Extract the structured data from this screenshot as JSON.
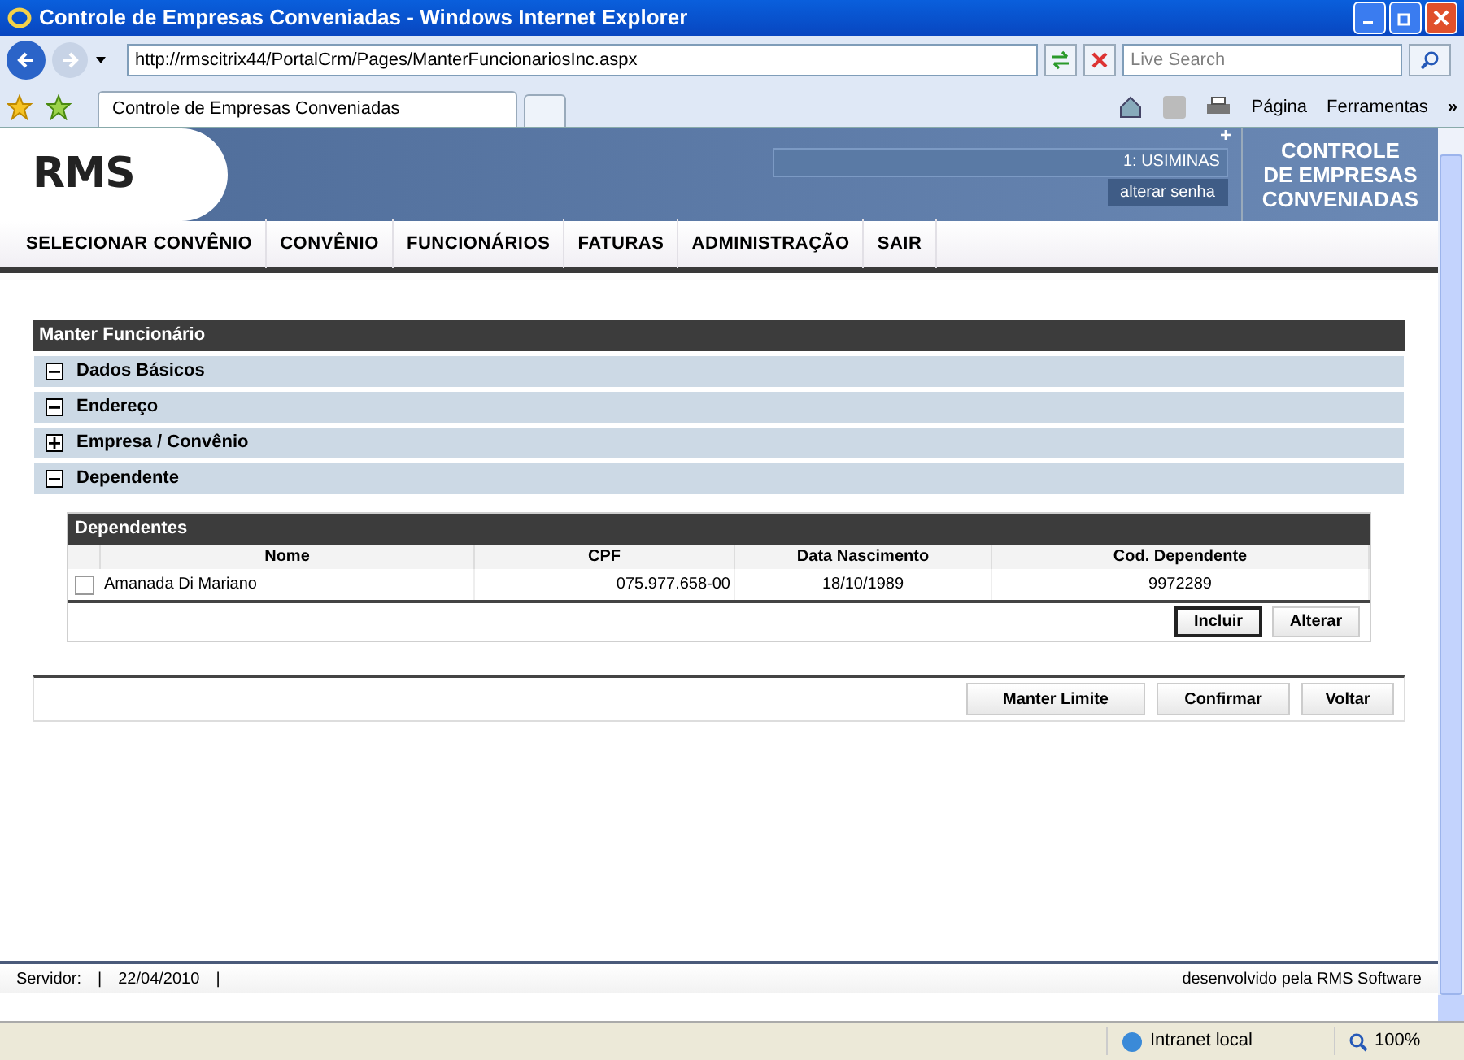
{
  "window": {
    "title": "Controle de Empresas Conveniadas - Windows Internet Explorer"
  },
  "browser": {
    "address": "http://rmscitrix44/PortalCrm/Pages/ManterFuncionariosInc.aspx",
    "search_placeholder": "Live Search",
    "tab": "Controle de Empresas Conveniadas",
    "page_menu": "Página",
    "tools_menu": "Ferramentas",
    "more": "»"
  },
  "header": {
    "logo": "RMS",
    "user": "1: USIMINAS",
    "change_password": "alterar senha",
    "app_title": [
      "CONTROLE",
      "DE EMPRESAS",
      "CONVENIADAS"
    ],
    "plus": "+"
  },
  "nav": [
    "SELECIONAR CONVÊNIO",
    "CONVÊNIO",
    "FUNCIONÁRIOS",
    "FATURAS",
    "ADMINISTRAÇÃO",
    "SAIR"
  ],
  "panel": {
    "title": "Manter Funcionário",
    "sections": [
      {
        "label": "Dados Básicos",
        "expanded": true
      },
      {
        "label": "Endereço",
        "expanded": true
      },
      {
        "label": "Empresa / Convênio",
        "expanded": false
      },
      {
        "label": "Dependente",
        "expanded": true
      }
    ],
    "grid": {
      "title": "Dependentes",
      "columns": [
        "Nome",
        "CPF",
        "Data Nascimento",
        "Cod. Dependente"
      ],
      "rows": [
        {
          "checked": false,
          "cells": [
            "Amanada Di Mariano",
            "075.977.658-00",
            "18/10/1989",
            "9972289"
          ]
        }
      ],
      "buttons": [
        {
          "label": "Incluir",
          "selected": true
        },
        {
          "label": "Alterar",
          "selected": false
        }
      ]
    },
    "buttons": [
      "Manter Limite",
      "Confirmar",
      "Voltar"
    ]
  },
  "footer": {
    "server": "Servidor:",
    "sep1": "|",
    "date": "22/04/2010",
    "sep2": "|",
    "credit": "desenvolvido pela RMS Software"
  },
  "status_bar": {
    "zone": "Intranet local",
    "zoom": "100%"
  }
}
